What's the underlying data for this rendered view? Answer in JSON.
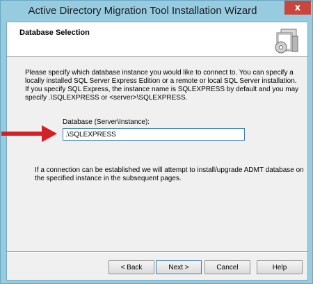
{
  "window": {
    "title": "Active Directory Migration Tool Installation Wizard",
    "close_glyph": "x"
  },
  "header": {
    "title": "Database Selection",
    "icon": "setup-box-icon"
  },
  "intro": {
    "text": "Please specify which database instance you would like to connect to. You can specify a locally installed SQL Server Express Edition or a remote or local SQL Server installation. If you specify SQL Express, the instance name is SQLEXPRESS by default and you may specify .\\SQLEXPRESS or <server>\\SQLEXPRESS."
  },
  "database": {
    "label": "Database (Server\\Instance):",
    "value": ".\\SQLEXPRESS"
  },
  "info": {
    "text": "If a connection can be established we will attempt to install/upgrade ADMT database on the specified instance in the subsequent pages."
  },
  "buttons": {
    "back": "< Back",
    "next": "Next >",
    "cancel": "Cancel",
    "help": "Help"
  },
  "colors": {
    "title_bar": "#97cbe0",
    "arrow": "#d32027",
    "close": "#c9463d"
  }
}
